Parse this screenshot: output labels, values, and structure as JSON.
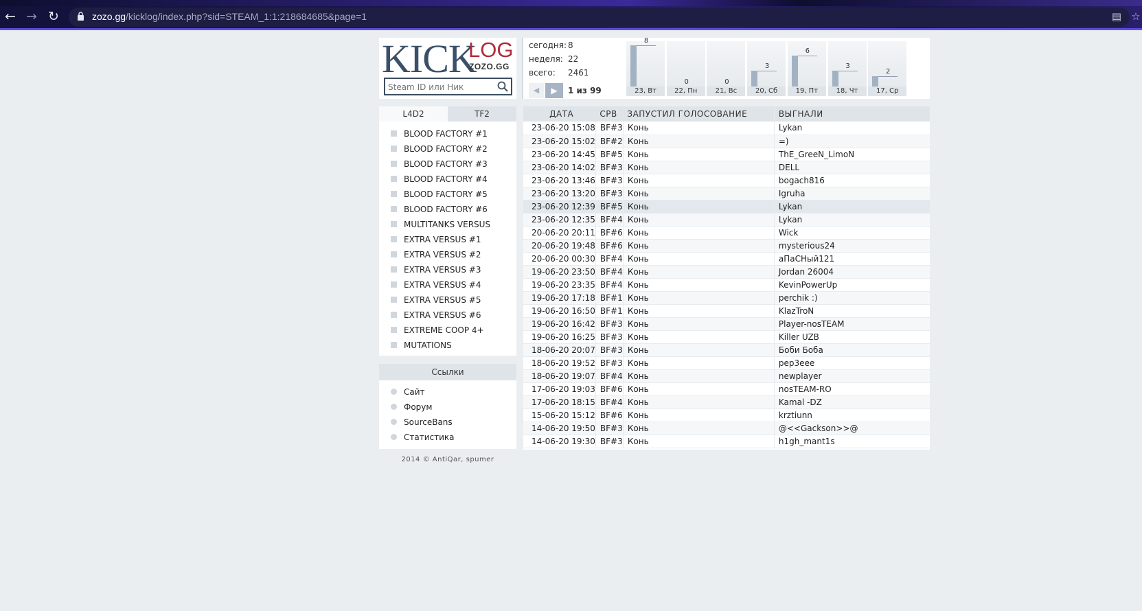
{
  "browser": {
    "url_host": "zozo.gg",
    "url_path": "/kicklog/index.php?sid=STEAM_1:1:218684685&page=1"
  },
  "logo": {
    "kick": "KICK",
    "log": "LOG",
    "sub": "ZOZO.GG"
  },
  "search": {
    "placeholder": "Steam ID или Ник"
  },
  "stats": [
    {
      "label": "сегодня:",
      "value": "8"
    },
    {
      "label": "неделя:",
      "value": "22"
    },
    {
      "label": "всего:",
      "value": "2461"
    }
  ],
  "pager": {
    "text": "1 из 99"
  },
  "chart_data": {
    "type": "bar",
    "categories": [
      "23, Вт",
      "22, Пн",
      "21, Вс",
      "20, Сб",
      "19, Пт",
      "18, Чт",
      "17, Ср"
    ],
    "values": [
      8,
      0,
      0,
      3,
      6,
      3,
      2
    ],
    "ylim": [
      0,
      8
    ]
  },
  "tabs": {
    "active": "L4D2",
    "inactive": "TF2"
  },
  "servers": [
    "BLOOD FACTORY #1",
    "BLOOD FACTORY #2",
    "BLOOD FACTORY #3",
    "BLOOD FACTORY #4",
    "BLOOD FACTORY #5",
    "BLOOD FACTORY #6",
    "MULTITANKS VERSUS",
    "EXTRA VERSUS #1",
    "EXTRA VERSUS #2",
    "EXTRA VERSUS #3",
    "EXTRA VERSUS #4",
    "EXTRA VERSUS #5",
    "EXTRA VERSUS #6",
    "EXTREME COOP 4+",
    "MUTATIONS"
  ],
  "links": {
    "title": "Ссылки",
    "items": [
      "Сайт",
      "Форум",
      "SourceBans",
      "Статистика"
    ]
  },
  "footer": "2014 © AntiQar, spumer",
  "table": {
    "headers": [
      "ДАТА",
      "СРВ",
      "ЗАПУСТИЛ ГОЛОСОВАНИЕ",
      "ВЫГНАЛИ"
    ],
    "rows": [
      [
        "23-06-20 15:08",
        "BF#3",
        "Конь",
        "Lykan"
      ],
      [
        "23-06-20 15:02",
        "BF#2",
        "Конь",
        "=)"
      ],
      [
        "23-06-20 14:45",
        "BF#5",
        "Конь",
        "ThE_GreeN_LimoN"
      ],
      [
        "23-06-20 14:02",
        "BF#3",
        "Конь",
        "DELL"
      ],
      [
        "23-06-20 13:46",
        "BF#3",
        "Конь",
        "bogach816"
      ],
      [
        "23-06-20 13:20",
        "BF#3",
        "Конь",
        "Igruha"
      ],
      [
        "23-06-20 12:39",
        "BF#5",
        "Конь",
        "Lykan"
      ],
      [
        "23-06-20 12:35",
        "BF#4",
        "Конь",
        "Lykan"
      ],
      [
        "20-06-20 20:11",
        "BF#6",
        "Конь",
        "Wick"
      ],
      [
        "20-06-20 19:48",
        "BF#6",
        "Конь",
        "mysterious24"
      ],
      [
        "20-06-20 00:30",
        "BF#4",
        "Конь",
        "аПаСНый121"
      ],
      [
        "19-06-20 23:50",
        "BF#4",
        "Конь",
        "Jordan 26004"
      ],
      [
        "19-06-20 23:35",
        "BF#4",
        "Конь",
        "KevinPowerUp"
      ],
      [
        "19-06-20 17:18",
        "BF#1",
        "Конь",
        "perchik :)"
      ],
      [
        "19-06-20 16:50",
        "BF#1",
        "Конь",
        "KlazTroN"
      ],
      [
        "19-06-20 16:42",
        "BF#3",
        "Конь",
        "Player-nosTEAM"
      ],
      [
        "19-06-20 16:25",
        "BF#3",
        "Конь",
        "Killer UZB"
      ],
      [
        "18-06-20 20:07",
        "BF#3",
        "Конь",
        "Боби Боба"
      ],
      [
        "18-06-20 19:52",
        "BF#3",
        "Конь",
        "pep3eee"
      ],
      [
        "18-06-20 19:07",
        "BF#4",
        "Конь",
        "newplayer"
      ],
      [
        "17-06-20 19:03",
        "BF#6",
        "Конь",
        "nosTEAM-RO"
      ],
      [
        "17-06-20 18:15",
        "BF#4",
        "Конь",
        "Kamal -DZ"
      ],
      [
        "15-06-20 15:12",
        "BF#6",
        "Конь",
        "krztiunn"
      ],
      [
        "14-06-20 19:50",
        "BF#3",
        "Конь",
        "@<<Gackson>>@"
      ],
      [
        "14-06-20 19:30",
        "BF#3",
        "Конь",
        "h1gh_mant1s"
      ]
    ],
    "highlighted_row": 6
  }
}
